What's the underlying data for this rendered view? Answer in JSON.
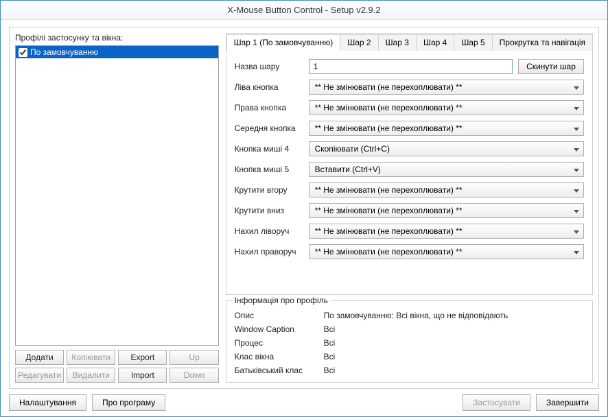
{
  "window": {
    "title": "X-Mouse Button Control - Setup v2.9.2"
  },
  "left": {
    "label": "Профілі застосунку та вікна:",
    "profile_item": "По замовчуванню",
    "buttons": {
      "add": "Додати",
      "copy": "Копіювати",
      "export": "Export",
      "up": "Up",
      "edit": "Редагувати",
      "delete": "Видалити",
      "import": "Import",
      "down": "Down"
    }
  },
  "tabs": {
    "t1": "Шар 1 (По замовчуванню)",
    "t2": "Шар 2",
    "t3": "Шар 3",
    "t4": "Шар 4",
    "t5": "Шар 5",
    "t6": "Прокрутка та навігація"
  },
  "layer": {
    "name_label": "Назва шару",
    "name_value": "1",
    "reset": "Скинути шар",
    "rows": {
      "left_btn": {
        "label": "Ліва кнопка",
        "value": "** Не змінювати (не перехоплювати) **"
      },
      "right_btn": {
        "label": "Права кнопка",
        "value": "** Не змінювати (не перехоплювати) **"
      },
      "middle_btn": {
        "label": "Середня кнопка",
        "value": "** Не змінювати (не перехоплювати) **"
      },
      "mouse4": {
        "label": "Кнопка миші 4",
        "value": "Скопіювати (Ctrl+C)"
      },
      "mouse5": {
        "label": "Кнопка миші 5",
        "value": "Вставити (Ctrl+V)"
      },
      "wheel_up": {
        "label": "Крутити вгору",
        "value": "** Не змінювати (не перехоплювати) **"
      },
      "wheel_down": {
        "label": "Крутити вниз",
        "value": "** Не змінювати (не перехоплювати) **"
      },
      "tilt_left": {
        "label": "Нахил ліворуч",
        "value": "** Не змінювати (не перехоплювати) **"
      },
      "tilt_right": {
        "label": "Нахил праворуч",
        "value": "** Не змінювати (не перехоплювати) **"
      }
    }
  },
  "info": {
    "title": "Інформація про профіль",
    "rows": {
      "desc": {
        "label": "Опис",
        "value": "По замовчуванню: Всі вікна, що не відповідають"
      },
      "caption": {
        "label": "Window Caption",
        "value": "Всі"
      },
      "process": {
        "label": "Процес",
        "value": "Всі"
      },
      "class": {
        "label": "Клас вікна",
        "value": "Всі"
      },
      "parent": {
        "label": "Батьківський клас",
        "value": "Всі"
      }
    }
  },
  "footer": {
    "settings": "Налаштування",
    "about": "Про програму",
    "apply": "Застосувати",
    "close": "Завершити"
  }
}
